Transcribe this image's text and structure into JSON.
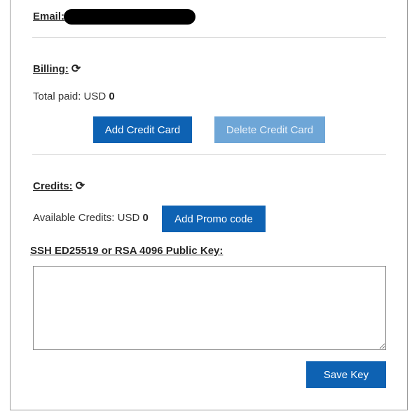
{
  "email": {
    "label": "Email:"
  },
  "billing": {
    "label": "Billing:",
    "refresh_glyph": "⟳",
    "total_paid_label": "Total paid: USD",
    "total_paid_value": "0",
    "add_card_label": "Add Credit Card",
    "delete_card_label": "Delete Credit Card"
  },
  "credits": {
    "label": "Credits:",
    "refresh_glyph": "⟳",
    "available_label": "Available Credits: USD",
    "available_value": "0",
    "promo_label": "Add Promo code"
  },
  "ssh": {
    "label": "SSH ED25519 or RSA 4096 Public Key:",
    "value": "",
    "save_label": "Save Key"
  },
  "colors": {
    "primary_button": "#0e62b3",
    "disabled_button": "#6ea6d7"
  }
}
